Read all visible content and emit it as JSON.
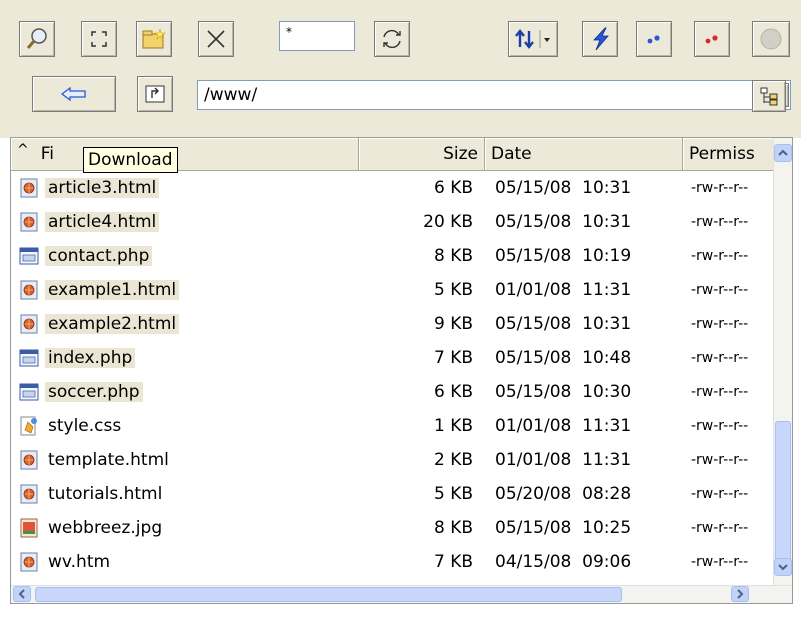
{
  "toolbar": {
    "icons": [
      "magnifier-icon",
      "fullscreen-icon",
      "new-folder-icon",
      "delete-x-icon",
      "refresh-icon",
      "sort-icon",
      "flash-icon",
      "blue-dots-icon",
      "red-dots-icon",
      "stop-icon"
    ],
    "mask_value": "*",
    "back_icon": "back-arrow-icon",
    "parent_icon": "parent-folder-icon",
    "tree_icon": "tree-view-icon"
  },
  "path": {
    "value": "/www/"
  },
  "tooltip": {
    "text": "Download"
  },
  "columns": {
    "sort_indicator": "^",
    "name": "Fi",
    "size": "Size",
    "date": "Date",
    "permissions": "Permiss"
  },
  "files": [
    {
      "name": "article3.html",
      "size": "6 KB",
      "date": "05/15/08  10:31",
      "perm": "-rw-r--r--",
      "icon": "html-file-icon",
      "selected": true
    },
    {
      "name": "article4.html",
      "size": "20 KB",
      "date": "05/15/08  10:31",
      "perm": "-rw-r--r--",
      "icon": "html-file-icon",
      "selected": true
    },
    {
      "name": "contact.php",
      "size": "8 KB",
      "date": "05/15/08  10:19",
      "perm": "-rw-r--r--",
      "icon": "php-file-icon",
      "selected": true
    },
    {
      "name": "example1.html",
      "size": "5 KB",
      "date": "01/01/08  11:31",
      "perm": "-rw-r--r--",
      "icon": "html-file-icon",
      "selected": true
    },
    {
      "name": "example2.html",
      "size": "9 KB",
      "date": "05/15/08  10:31",
      "perm": "-rw-r--r--",
      "icon": "html-file-icon",
      "selected": true
    },
    {
      "name": "index.php",
      "size": "7 KB",
      "date": "05/15/08  10:48",
      "perm": "-rw-r--r--",
      "icon": "php-file-icon",
      "selected": true
    },
    {
      "name": "soccer.php",
      "size": "6 KB",
      "date": "05/15/08  10:30",
      "perm": "-rw-r--r--",
      "icon": "php-file-icon",
      "selected": true
    },
    {
      "name": "style.css",
      "size": "1 KB",
      "date": "01/01/08  11:31",
      "perm": "-rw-r--r--",
      "icon": "css-file-icon",
      "selected": false
    },
    {
      "name": "template.html",
      "size": "2 KB",
      "date": "01/01/08  11:31",
      "perm": "-rw-r--r--",
      "icon": "html-file-icon",
      "selected": false
    },
    {
      "name": "tutorials.html",
      "size": "5 KB",
      "date": "05/20/08  08:28",
      "perm": "-rw-r--r--",
      "icon": "html-file-icon",
      "selected": false
    },
    {
      "name": "webbreez.jpg",
      "size": "8 KB",
      "date": "05/15/08  10:25",
      "perm": "-rw-r--r--",
      "icon": "jpg-file-icon",
      "selected": false
    },
    {
      "name": "wv.htm",
      "size": "7 KB",
      "date": "04/15/08  09:06",
      "perm": "-rw-r--r--",
      "icon": "html-file-icon",
      "selected": false
    }
  ],
  "colors": {
    "toolbar_bg": "#ece9d8",
    "selection": "#ebe6d4",
    "scroll_accent": "#c8d6fb"
  }
}
